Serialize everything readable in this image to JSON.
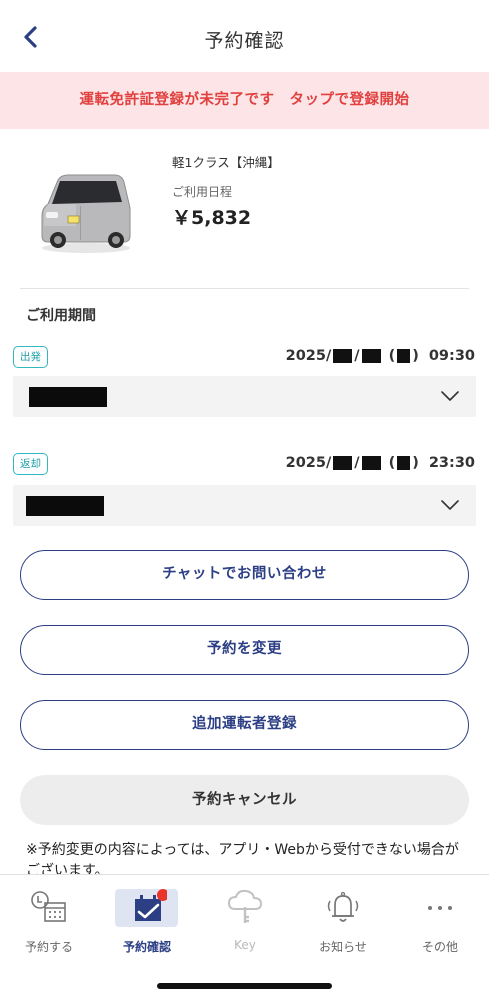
{
  "header": {
    "title": "予約確認"
  },
  "alert": {
    "text": "運転免許証登録が未完了です　タップで登録開始"
  },
  "car": {
    "class": "軽1クラス【沖縄】",
    "schedule_label": "ご利用日程",
    "price": "￥5,832"
  },
  "period": {
    "label": "ご利用期間",
    "departure": {
      "badge": "出発",
      "year": "2025/",
      "open_paren": "(",
      "close_paren": ")",
      "time": "09:30"
    },
    "return": {
      "badge": "返却",
      "year": "2025/",
      "open_paren": "(",
      "close_paren": ")",
      "time": "23:30"
    }
  },
  "buttons": {
    "chat": "チャットでお問い合わせ",
    "change": "予約を変更",
    "add_driver": "追加運転者登録",
    "cancel": "予約キャンセル"
  },
  "note": "※予約変更の内容によっては、アプリ・Webから受付できない場合がございます。",
  "tabs": [
    {
      "label": "予約する",
      "icon": "calendar-clock-icon"
    },
    {
      "label": "予約確認",
      "icon": "calendar-check-icon",
      "active": true
    },
    {
      "label": "Key",
      "icon": "key-cloud-icon"
    },
    {
      "label": "お知らせ",
      "icon": "bell-icon"
    },
    {
      "label": "その他",
      "icon": "more-icon"
    }
  ],
  "colors": {
    "accent": "#2c3f85",
    "alert_bg": "#fde5e7",
    "alert_text": "#e0403e",
    "badge": "#33b8c0",
    "notification_dot": "#e8342a"
  }
}
